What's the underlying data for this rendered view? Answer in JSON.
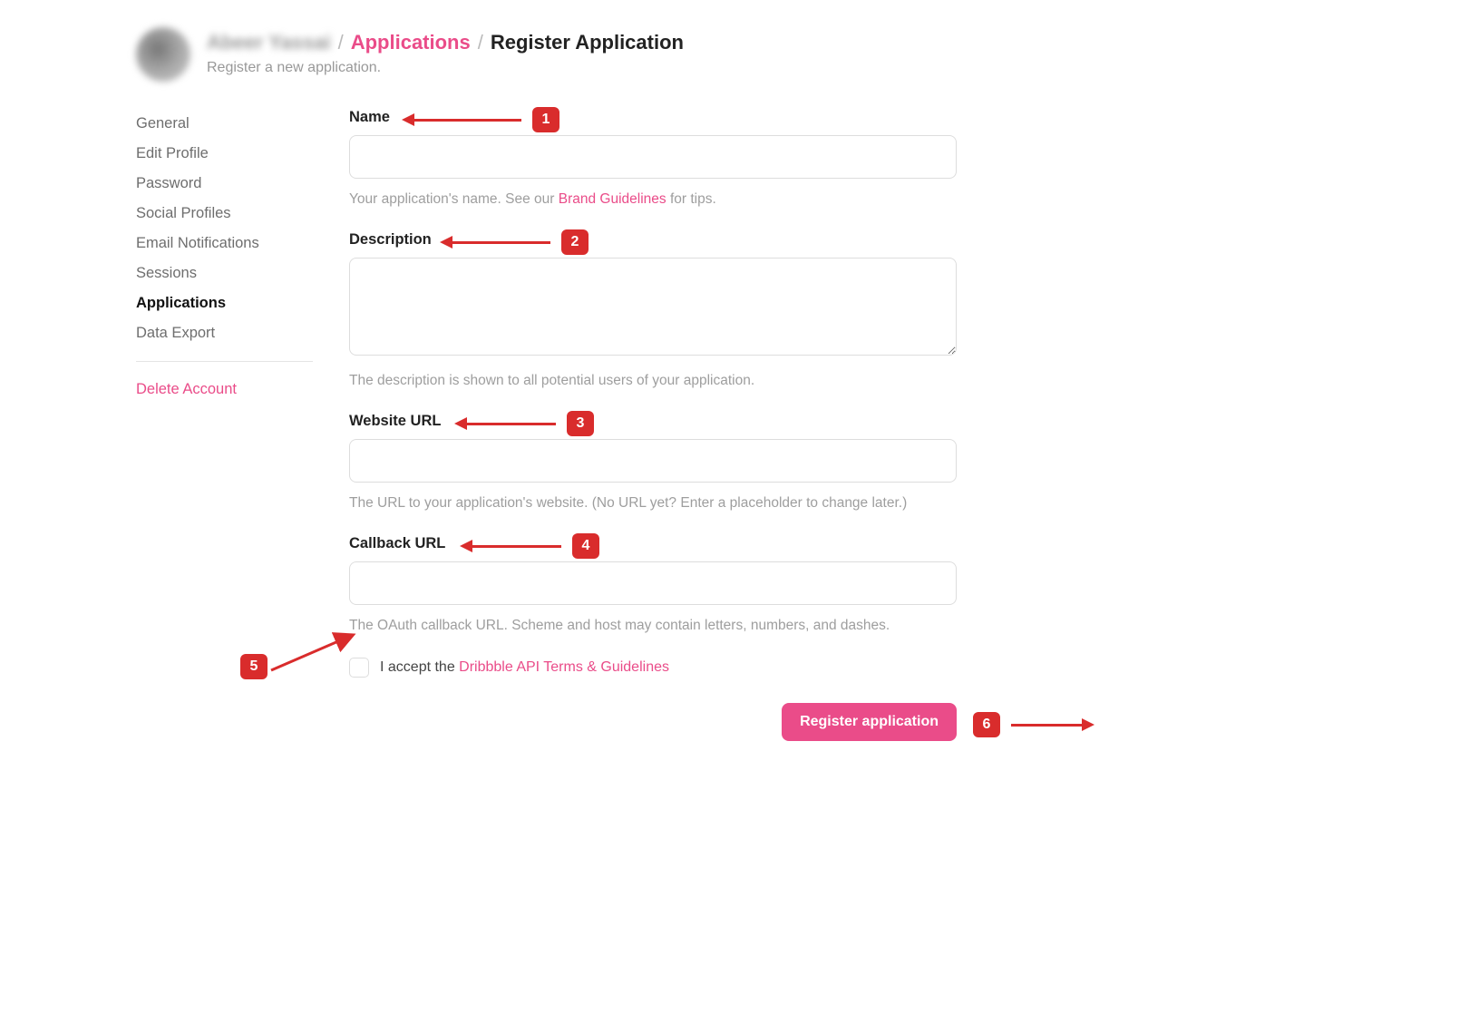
{
  "header": {
    "user_name": "Abeer Yassai",
    "breadcrumb_link": "Applications",
    "breadcrumb_current": "Register Application",
    "subtitle": "Register a new application."
  },
  "sidebar": {
    "items": [
      {
        "label": "General"
      },
      {
        "label": "Edit Profile"
      },
      {
        "label": "Password"
      },
      {
        "label": "Social Profiles"
      },
      {
        "label": "Email Notifications"
      },
      {
        "label": "Sessions"
      },
      {
        "label": "Applications",
        "active": true
      },
      {
        "label": "Data Export"
      }
    ],
    "delete_label": "Delete Account"
  },
  "form": {
    "name": {
      "label": "Name",
      "value": "",
      "hint_prefix": "Your application's name. See our ",
      "hint_link": "Brand Guidelines",
      "hint_suffix": " for tips."
    },
    "description": {
      "label": "Description",
      "value": "",
      "hint": "The description is shown to all potential users of your application."
    },
    "website": {
      "label": "Website URL",
      "value": "",
      "hint": "The URL to your application's website. (No URL yet? Enter a placeholder to change later.)"
    },
    "callback": {
      "label": "Callback URL",
      "value": "",
      "hint": "The OAuth callback URL. Scheme and host may contain letters, numbers, and dashes."
    },
    "terms": {
      "prefix": "I accept the ",
      "link": "Dribbble API Terms & Guidelines"
    },
    "submit_label": "Register application"
  },
  "annotations": {
    "a1": "1",
    "a2": "2",
    "a3": "3",
    "a4": "4",
    "a5": "5",
    "a6": "6"
  }
}
